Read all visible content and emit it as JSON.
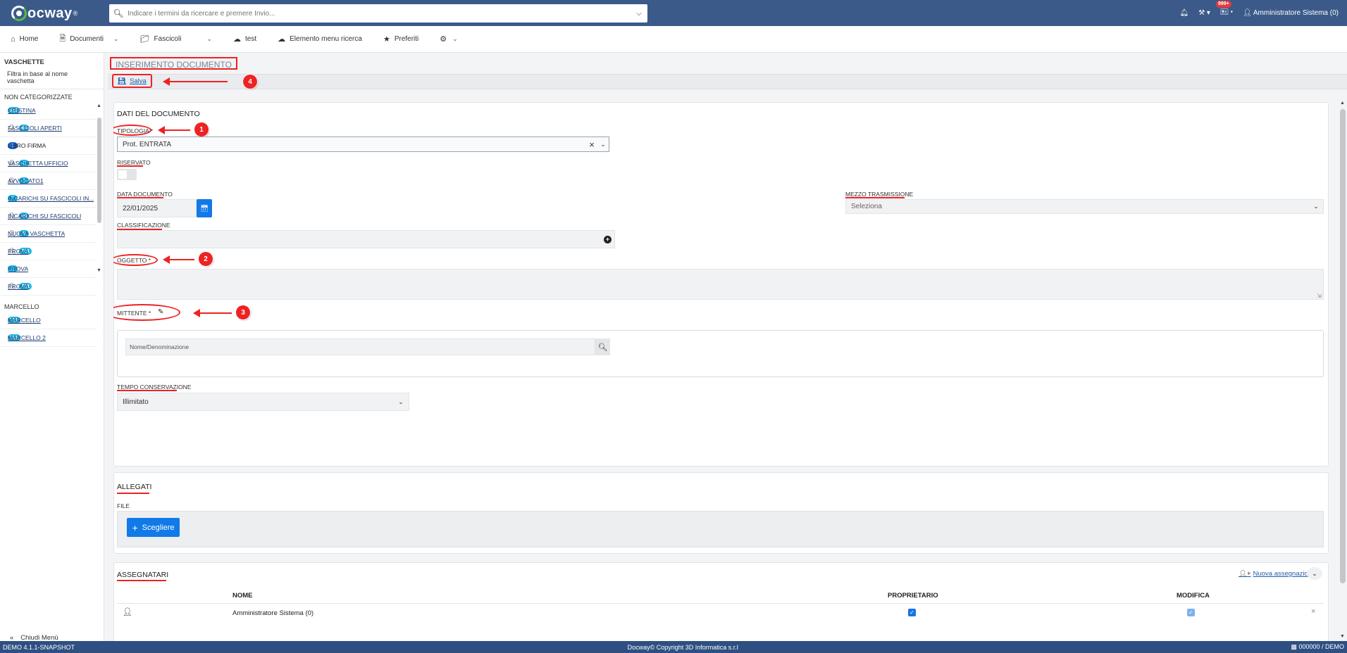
{
  "app": {
    "logo": "ocway",
    "logo_mark": "®"
  },
  "search": {
    "placeholder": "Indicare i termini da ricercare e premere Invio..."
  },
  "topbar": {
    "notif_badge": "999+",
    "user": "Amministratore Sistema (0)"
  },
  "menu": [
    {
      "label": "Home",
      "icon": "home-icon"
    },
    {
      "label": "Documenti",
      "icon": "document-icon"
    },
    {
      "label": "Fascicoli",
      "icon": "folder-icon"
    },
    {
      "label": "test",
      "icon": "cloud-icon"
    },
    {
      "label": "Elemento menu ricerca",
      "icon": "cloud-icon"
    },
    {
      "label": "Preferiti",
      "icon": "star-icon"
    }
  ],
  "sidebar": {
    "title": "VASCHETTE",
    "filter_placeholder": "Filtra in base al nome vaschetta",
    "cat1": "NON CATEGORIZZATE",
    "items": [
      {
        "label": "Cristina",
        "count": "118",
        "user": false
      },
      {
        "label": "Fascicoli aperti",
        "count": "64",
        "user": true
      },
      {
        "label": "Libro firma",
        "count": "0",
        "user": false
      },
      {
        "label": "Vaschetta ufficio",
        "count": "2",
        "user": true
      },
      {
        "label": "avvocato1",
        "count": "3",
        "user": true
      },
      {
        "label": "incarichi su fascicoli in...",
        "count": "7",
        "user": false
      },
      {
        "label": "incarichi su fascicoli",
        "count": "46",
        "user": true
      },
      {
        "label": "nuova vaschetta",
        "count": "5",
        "user": true
      },
      {
        "label": "prova",
        "count": "731",
        "user": true
      },
      {
        "label": "prova",
        "count": "1",
        "user": false
      },
      {
        "label": "prova",
        "count": "731",
        "user": true
      }
    ],
    "cat2": "MARCELLO",
    "items2": [
      {
        "label": "marcello",
        "count": "731"
      },
      {
        "label": "marcello 2",
        "count": "731"
      }
    ],
    "close": "Chiudi Menù"
  },
  "page": {
    "title": "INSERIMENTO DOCUMENTO",
    "save": "Salva"
  },
  "form": {
    "section": "DATI DEL DOCUMENTO",
    "tipologia_label": "TIPOLOGIA *",
    "tipologia_value": "Prot. ENTRATA",
    "riservato_label": "RISERVATO",
    "data_label": "DATA DOCUMENTO",
    "data_value": "22/01/2025",
    "mezzo_label": "MEZZO TRASMISSIONE",
    "mezzo_value": "Seleziona",
    "classificazione_label": "CLASSIFICAZIONE",
    "oggetto_label": "OGGETTO *",
    "mittente_label": "MITTENTE *",
    "mittente_placeholder": "Nome/Denominazione",
    "tempo_label": "TEMPO CONSERVAZIONE",
    "tempo_value": "Illimitato"
  },
  "allegati": {
    "title": "ALLEGATI",
    "file_label": "FILE",
    "button": "Scegliere"
  },
  "assegnatari": {
    "title": "ASSEGNATARI",
    "new": "Nuova assegnazione",
    "col_nome": "NOME",
    "col_prop": "PROPRIETARIO",
    "col_mod": "MODIFICA",
    "row_name": "Amministratore Sistema (0)"
  },
  "annotations": [
    "1",
    "2",
    "3",
    "4"
  ],
  "footer": {
    "left": "DEMO 4.1.1-SNAPSHOT",
    "center": "Docway© Copyright 3D Informatica s.r.l",
    "right": "000000 / DEMO"
  },
  "colors": {
    "topbar": "#3b5a8a",
    "accent": "#1179e8",
    "annotation": "#e22222",
    "footer": "#2e4f82"
  }
}
